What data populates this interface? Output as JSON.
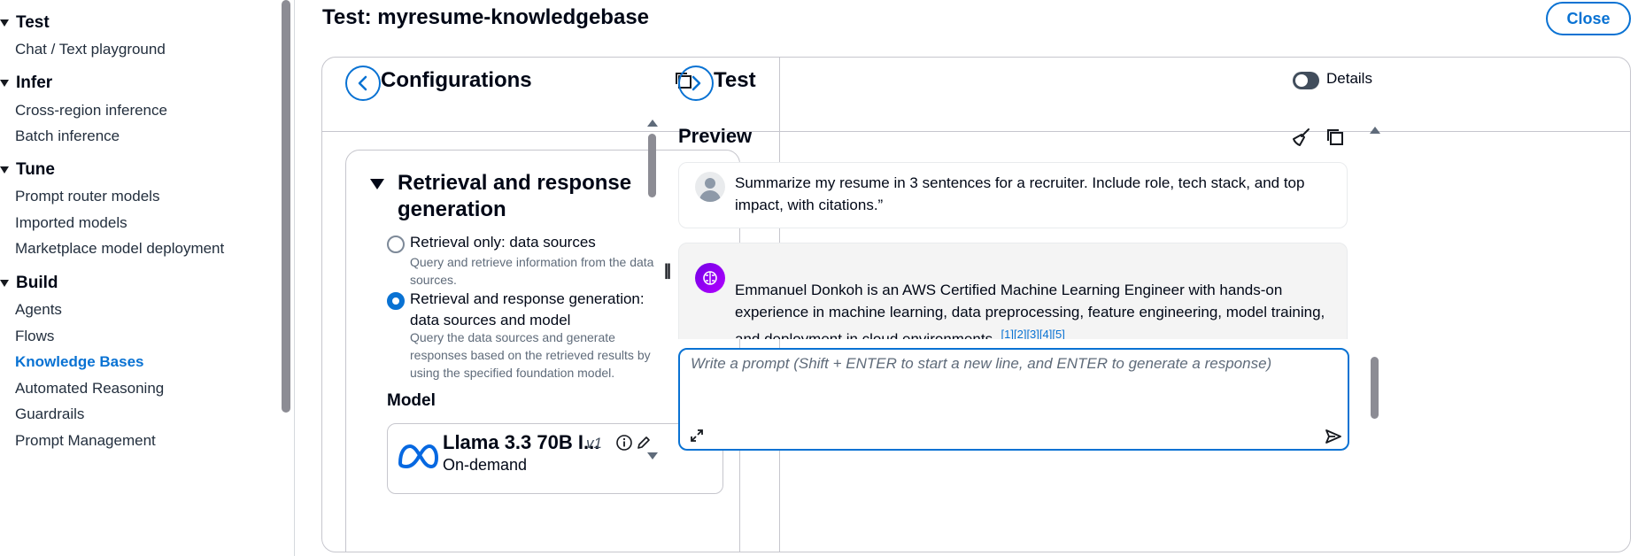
{
  "nav": {
    "sections": [
      {
        "title": "Test",
        "items": [
          "Chat / Text playground"
        ]
      },
      {
        "title": "Infer",
        "items": [
          "Cross-region inference",
          "Batch inference"
        ]
      },
      {
        "title": "Tune",
        "items": [
          "Prompt router models",
          "Imported models",
          "Marketplace model deployment"
        ]
      },
      {
        "title": "Build",
        "items": [
          "Agents",
          "Flows",
          "Knowledge Bases",
          "Automated Reasoning",
          "Guardrails",
          "Prompt Management"
        ]
      }
    ],
    "active_item": "Knowledge Bases"
  },
  "header": {
    "title": "Test: myresume-knowledgebase",
    "close_label": "Close"
  },
  "config_panel": {
    "title": "Configurations",
    "section_title": "Retrieval and response generation",
    "options": [
      {
        "label": "Retrieval only: data sources",
        "description": "Query and retrieve information from the data sources.",
        "selected": false
      },
      {
        "label": "Retrieval and response generation: data sources and model",
        "description": "Query the data sources and generate responses based on the retrieved results by using the specified foundation model.",
        "selected": true
      }
    ],
    "model_label": "Model",
    "model": {
      "name": "Llama 3.3 70B I...",
      "version": "v1",
      "mode": "On-demand"
    }
  },
  "test_panel": {
    "title": "Test",
    "details_label": "Details",
    "details_toggle_on": false,
    "preview_title": "Preview",
    "user_message": "Summarize my resume in 3 sentences for a recruiter. Include role, tech stack, and top impact, with citations.”",
    "bot_message": "Emmanuel Donkoh is an AWS Certified Machine Learning Engineer with hands-on experience in machine learning, data preprocessing, feature engineering, model training, and deployment in cloud environments.",
    "bot_citations": "[1][2][3][4][5]",
    "prompt_placeholder": "Write a prompt (Shift + ENTER to start a new line, and ENTER to generate a response)"
  },
  "colors": {
    "accent": "#0972d3",
    "text": "#000716",
    "border": "#c6c6cd",
    "bot_avatar": "#8a00f0"
  },
  "icons": [
    "back-chevron-icon",
    "forward-chevron-icon",
    "copy-icon",
    "broom-icon",
    "info-icon",
    "pencil-icon",
    "expand-icon",
    "send-icon",
    "meta-logo-icon",
    "user-avatar-icon",
    "bot-brain-icon"
  ]
}
